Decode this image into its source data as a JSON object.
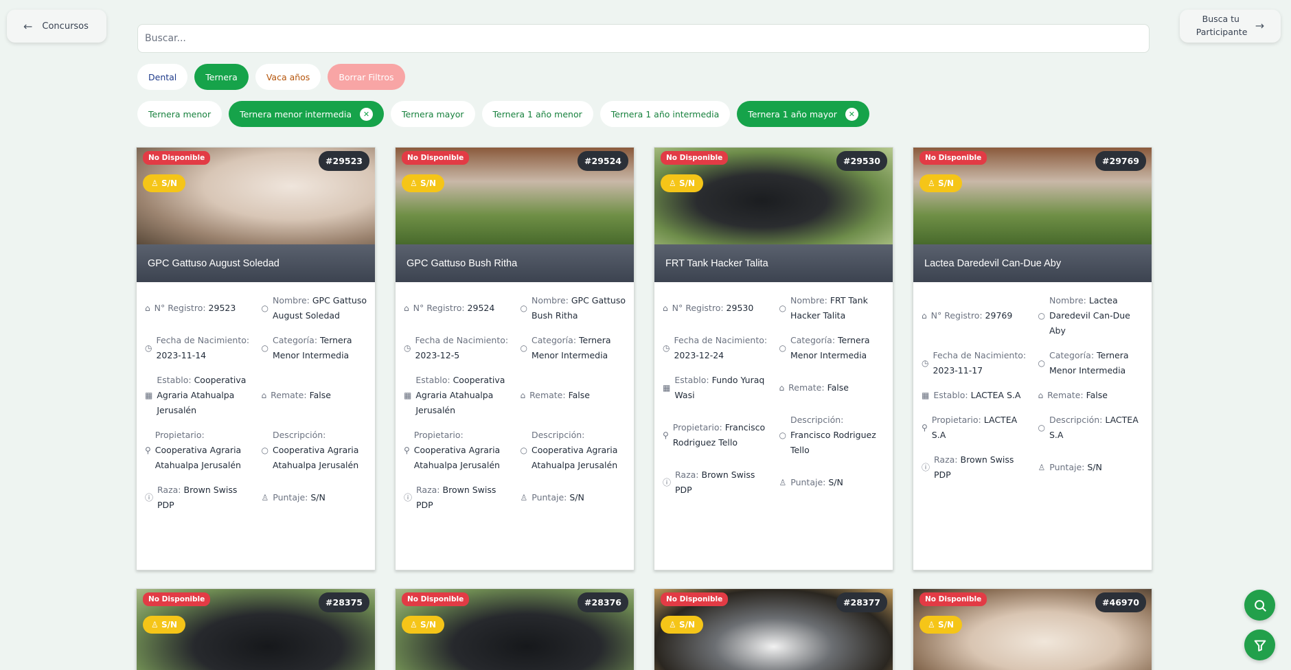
{
  "nav": {
    "back_label": "Concursos",
    "participant_label": "Busca tu Participante"
  },
  "search": {
    "placeholder": "Buscar..."
  },
  "filters_row1": [
    {
      "label": "Dental",
      "active": false
    },
    {
      "label": "Ternera",
      "active": true
    },
    {
      "label": "Vaca años",
      "active": false
    },
    {
      "label": "Borrar Filtros",
      "active": false
    }
  ],
  "filters_row2": [
    {
      "label": "Ternera menor",
      "active": false
    },
    {
      "label": "Ternera menor intermedia",
      "active": true
    },
    {
      "label": "Ternera mayor",
      "active": false
    },
    {
      "label": "Ternera 1 año menor",
      "active": false
    },
    {
      "label": "Ternera 1 año intermedia",
      "active": false
    },
    {
      "label": "Ternera 1 año mayor",
      "active": true
    }
  ],
  "badges": {
    "unavailable": "No Disponible",
    "score": "S/N"
  },
  "field_labels": {
    "registro": "N° Registro:",
    "nombre": "Nombre:",
    "nacimiento": "Fecha de Nacimiento:",
    "categoria": "Categoría:",
    "establo": "Establo:",
    "remate": "Remate:",
    "propietario": "Propietario:",
    "descripcion": "Descripción:",
    "raza": "Raza:",
    "puntaje": "Puntaje:"
  },
  "cards": [
    {
      "id": "#29523",
      "title": "GPC Gattuso August Soledad",
      "registro": "29523",
      "nombre": "GPC Gattuso August Soledad",
      "nacimiento": "2023-11-14",
      "categoria": "Ternera Menor Intermedia",
      "establo": "Cooperativa Agraria Atahualpa Jerusalén",
      "remate": "False",
      "propietario": "Cooperativa Agraria Atahualpa Jerusalén",
      "descripcion": "Cooperativa Agraria Atahualpa Jerusalén",
      "raza": "Brown Swiss PDP",
      "puntaje": "S/N"
    },
    {
      "id": "#29524",
      "title": "GPC Gattuso Bush Ritha",
      "registro": "29524",
      "nombre": "GPC Gattuso Bush Ritha",
      "nacimiento": "2023-12-5",
      "categoria": "Ternera Menor Intermedia",
      "establo": "Cooperativa Agraria Atahualpa Jerusalén",
      "remate": "False",
      "propietario": "Cooperativa Agraria Atahualpa Jerusalén",
      "descripcion": "Cooperativa Agraria Atahualpa Jerusalén",
      "raza": "Brown Swiss PDP",
      "puntaje": "S/N"
    },
    {
      "id": "#29530",
      "title": "FRT Tank Hacker Talita",
      "registro": "29530",
      "nombre": "FRT Tank Hacker Talita",
      "nacimiento": "2023-12-24",
      "categoria": "Ternera Menor Intermedia",
      "establo": "Fundo Yuraq Wasi",
      "remate": "False",
      "propietario": "Francisco Rodriguez Tello",
      "descripcion": "Francisco Rodriguez Tello",
      "raza": "Brown Swiss PDP",
      "puntaje": "S/N"
    },
    {
      "id": "#29769",
      "title": "Lactea Daredevil Can-Due Aby",
      "registro": "29769",
      "nombre": "Lactea Daredevil Can-Due Aby",
      "nacimiento": "2023-11-17",
      "categoria": "Ternera Menor Intermedia",
      "establo": "LACTEA S.A",
      "remate": "False",
      "propietario": "LACTEA S.A",
      "descripcion": "LACTEA S.A",
      "raza": "Brown Swiss PDP",
      "puntaje": "S/N"
    }
  ],
  "cards_bottom": [
    {
      "id": "#28375"
    },
    {
      "id": "#28376"
    },
    {
      "id": "#28377"
    },
    {
      "id": "#46970"
    }
  ],
  "colors": {
    "accent": "#16a34a",
    "unavailable": "#e23b45",
    "score_badge": "#f5c518",
    "background": "#eef4f1"
  },
  "icons": {
    "back": "arrow-left-icon",
    "forward": "arrow-right-icon",
    "fab_search": "search-icon",
    "fab_filter": "filter-icon"
  }
}
